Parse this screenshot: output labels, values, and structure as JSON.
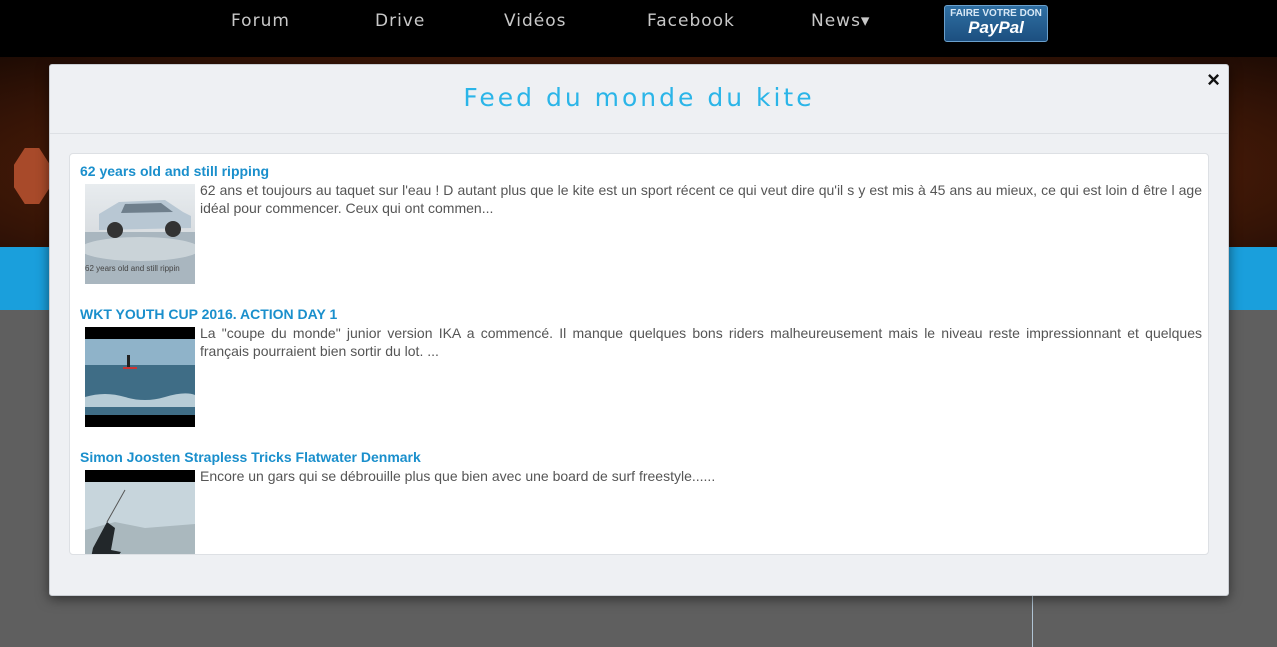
{
  "nav": {
    "items": [
      "Forum",
      "Drive",
      "Vidéos",
      "Facebook",
      "News▾"
    ],
    "paypal_line1": "FAIRE VOTRE DON",
    "paypal_line2": "PayPal"
  },
  "modal": {
    "title": "Feed du monde du kite",
    "close_label": "×"
  },
  "feed": [
    {
      "title": "62 years old and still ripping",
      "description": "62 ans et toujours au taquet sur l'eau  !  D autant plus que le kite est un sport récent ce qui veut dire qu'il s y est mis à 45 ans au mieux, ce qui est loin d être l age idéal pour commencer. Ceux qui ont commen...",
      "thumb_caption": "62 years old and still rippin"
    },
    {
      "title": "WKT YOUTH CUP 2016. ACTION DAY 1",
      "description": "La \"coupe du monde\" junior version IKA a commencé. Il manque quelques bons riders malheureusement mais le niveau reste impressionnant et quelques français pourraient bien sortir du lot. ..."
    },
    {
      "title": "Simon Joosten Strapless Tricks Flatwater Denmark",
      "description": "Encore un gars qui se débrouille plus que bien avec une board de surf freestyle......"
    }
  ],
  "colors": {
    "accent": "#2bb5e8",
    "link": "#1a8fcc",
    "bluebar": "#1a9fdc"
  }
}
